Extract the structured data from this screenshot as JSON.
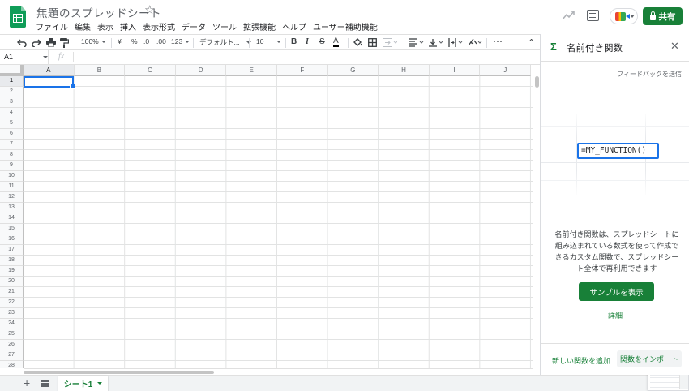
{
  "header": {
    "doc_title": "無題のスプレッドシート",
    "star_icon": "☆",
    "menu": [
      "ファイル",
      "編集",
      "表示",
      "挿入",
      "表示形式",
      "データ",
      "ツール",
      "拡張機能",
      "ヘルプ",
      "ユーザー補助機能"
    ],
    "share_label": "共有",
    "share_color": "#188038"
  },
  "toolbar": {
    "zoom": "100%",
    "currency": "¥",
    "percent": "%",
    "dec_decrease": ".0",
    "dec_increase": ".00",
    "more_formats": "123",
    "font": "デフォルト...",
    "font_size": "10",
    "bold": "B",
    "italic": "I",
    "strike": "S",
    "text_color": "A",
    "more": "⋯",
    "collapse": "⌃"
  },
  "formula_bar": {
    "name_box": "A1",
    "fx": "fx"
  },
  "grid": {
    "columns": [
      "A",
      "B",
      "C",
      "D",
      "E",
      "F",
      "G",
      "H",
      "I",
      "J"
    ],
    "rows": [
      "1",
      "2",
      "3",
      "4",
      "5",
      "6",
      "7",
      "8",
      "9",
      "10",
      "11",
      "12",
      "13",
      "14",
      "15",
      "16",
      "17",
      "18",
      "19",
      "20",
      "21",
      "22",
      "23",
      "24",
      "25",
      "26",
      "27",
      "28"
    ],
    "selected_cell": "A1"
  },
  "sheet_tabs": {
    "add": "+",
    "active_tab": "シート1"
  },
  "panel": {
    "sigma": "Σ",
    "title": "名前付き関数",
    "close": "✕",
    "feedback": "フィードバックを送信",
    "example_formula": "=MY_FUNCTION()",
    "description": "名前付き関数は、スプレッドシートに組み込まれている数式を使って作成できるカスタム関数で、スプレッドシート全体で再利用できます",
    "sample_button": "サンプルを表示",
    "details_link": "詳細",
    "add_function": "新しい関数を追加",
    "import_function": "関数をインポート",
    "accent_color": "#188038"
  }
}
